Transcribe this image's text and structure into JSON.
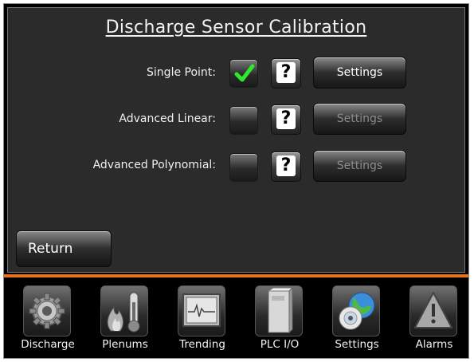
{
  "title": "Discharge Sensor Calibration",
  "rows": [
    {
      "label": "Single Point:",
      "checked": true,
      "help_label": "?",
      "settings_label": "Settings",
      "settings_enabled": true
    },
    {
      "label": "Advanced Linear:",
      "checked": false,
      "help_label": "?",
      "settings_label": "Settings",
      "settings_enabled": false
    },
    {
      "label": "Advanced Polynomial:",
      "checked": false,
      "help_label": "?",
      "settings_label": "Settings",
      "settings_enabled": false
    }
  ],
  "return_label": "Return",
  "nav": [
    {
      "label": "Discharge",
      "icon": "gear-icon"
    },
    {
      "label": "Plenums",
      "icon": "flame-thermometer-icon"
    },
    {
      "label": "Trending",
      "icon": "trend-graph-icon"
    },
    {
      "label": "PLC I/O",
      "icon": "plc-module-icon"
    },
    {
      "label": "Settings",
      "icon": "globe-cd-icon"
    },
    {
      "label": "Alarms",
      "icon": "warning-icon"
    }
  ],
  "colors": {
    "accent_bar": "#e8731a",
    "check": "#2ee82e",
    "panel": "#2b2b2b"
  }
}
